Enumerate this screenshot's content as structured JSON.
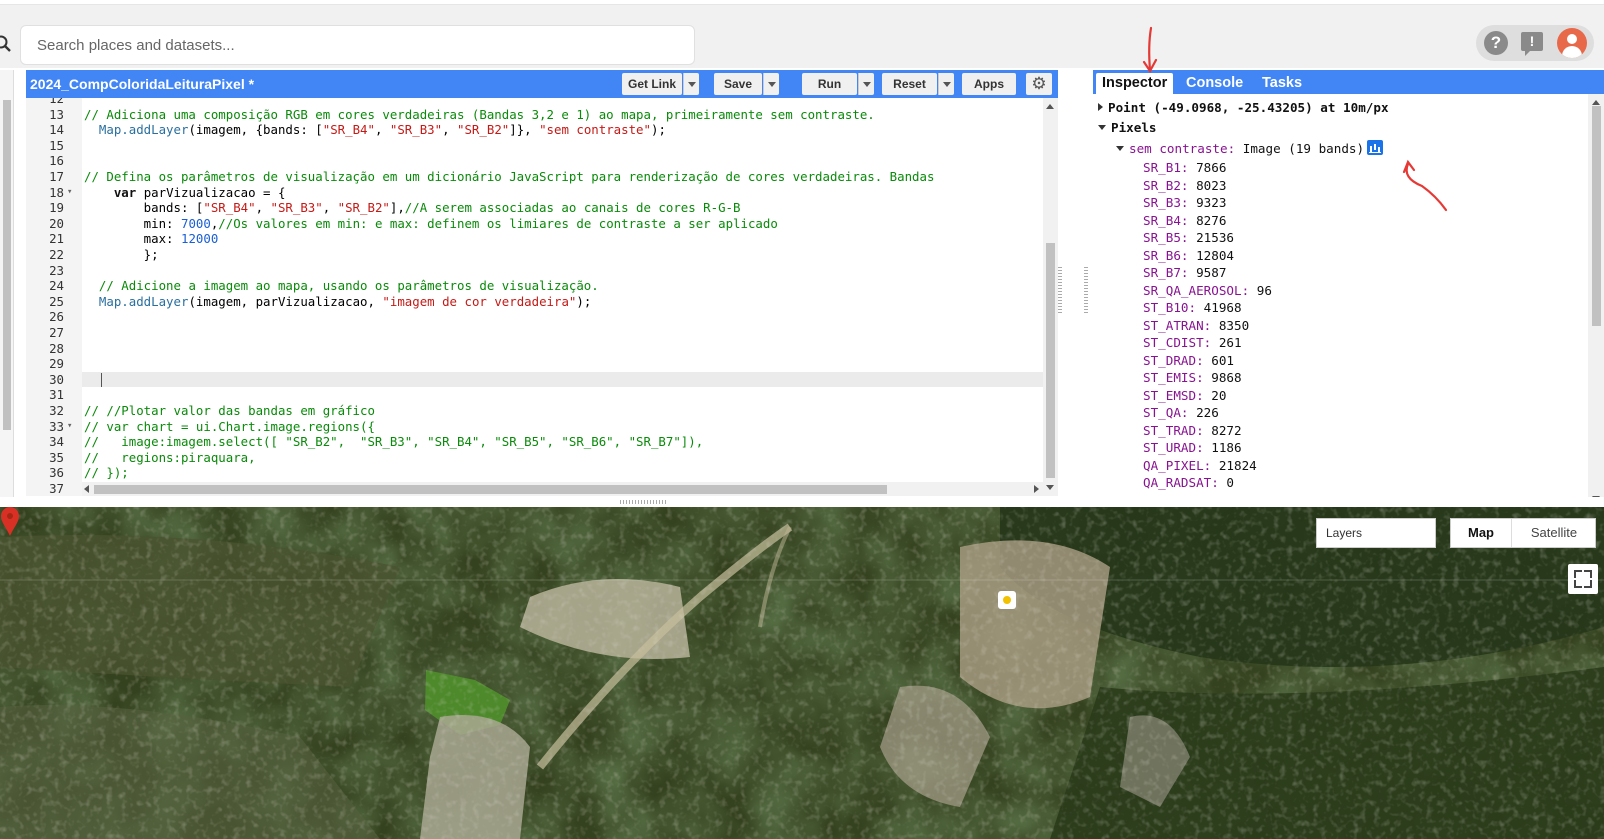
{
  "header": {
    "search_placeholder": "Search places and datasets..."
  },
  "editor": {
    "title": "2024_CompColoridaLeituraPixel *",
    "buttons": {
      "get_link": "Get Link",
      "save": "Save",
      "run": "Run",
      "reset": "Reset",
      "apps": "Apps"
    },
    "lines": [
      {
        "n": "12",
        "html": ""
      },
      {
        "n": "13",
        "html": "<span class=\"cm\">// Adiciona uma composição RGB em cores verdadeiras (Bandas 3,2 e 1) ao mapa, primeiramente sem contraste.</span>"
      },
      {
        "n": "14",
        "html": "  <span class=\"mp\">Map.addLayer</span>(imagem, {bands: [<span class=\"st\">\"SR_B4\"</span>, <span class=\"st\">\"SR_B3\"</span>, <span class=\"st\">\"SR_B2\"</span>]}, <span class=\"st\">\"sem contraste\"</span>);"
      },
      {
        "n": "15",
        "html": ""
      },
      {
        "n": "16",
        "html": ""
      },
      {
        "n": "17",
        "html": "<span class=\"cm\">// Defina os parâmetros de visualização em um dicionário JavaScript para renderização de cores verdadeiras. Bandas</span>"
      },
      {
        "n": "18",
        "fold": true,
        "html": "    <span class=\"kw\">var</span> parVizualizacao = {"
      },
      {
        "n": "19",
        "html": "        bands: [<span class=\"st\">\"SR_B4\"</span>, <span class=\"st\">\"SR_B3\"</span>, <span class=\"st\">\"SR_B2\"</span>],<span class=\"cm\">//A serem associadas ao canais de cores R-G-B</span>"
      },
      {
        "n": "20",
        "html": "        min: <span class=\"nm\">7000</span>,<span class=\"cm\">//Os valores em min: e max: definem os limiares de contraste a ser aplicado</span>"
      },
      {
        "n": "21",
        "html": "        max: <span class=\"nm\">12000</span>"
      },
      {
        "n": "22",
        "html": "        };"
      },
      {
        "n": "23",
        "html": ""
      },
      {
        "n": "24",
        "html": "  <span class=\"cm\">// Adicione a imagem ao mapa, usando os parâmetros de visualização.</span>"
      },
      {
        "n": "25",
        "html": "  <span class=\"mp\">Map.addLayer</span>(imagem, parVizualizacao, <span class=\"st\">\"imagem de cor verdadeira\"</span>);"
      },
      {
        "n": "26",
        "html": ""
      },
      {
        "n": "27",
        "html": ""
      },
      {
        "n": "28",
        "html": ""
      },
      {
        "n": "29",
        "html": ""
      },
      {
        "n": "30",
        "html": "",
        "active": true
      },
      {
        "n": "31",
        "html": ""
      },
      {
        "n": "32",
        "html": "<span class=\"cm\">// //Plotar valor das bandas em gráfico</span>"
      },
      {
        "n": "33",
        "fold": true,
        "html": "<span class=\"cm\">// var chart = ui.Chart.image.regions({</span>"
      },
      {
        "n": "34",
        "html": "<span class=\"cm\">//   image:imagem.select([ \"SR_B2\",  \"SR_B3\", \"SR_B4\", \"SR_B5\", \"SR_B6\", \"SR_B7\"]),</span>"
      },
      {
        "n": "35",
        "html": "<span class=\"cm\">//   regions:piraquara,</span>"
      },
      {
        "n": "36",
        "html": "<span class=\"cm\">// });</span>"
      },
      {
        "n": "37",
        "html": ""
      }
    ]
  },
  "inspector": {
    "tabs": [
      "Inspector",
      "Console",
      "Tasks"
    ],
    "point": "Point (-49.0968, -25.43205) at 10m/px",
    "pixels_label": "Pixels",
    "layer_name": "sem contraste:",
    "layer_desc": "Image (19 bands)",
    "bands": [
      {
        "k": "SR_B1:",
        "v": "7866"
      },
      {
        "k": "SR_B2:",
        "v": "8023"
      },
      {
        "k": "SR_B3:",
        "v": "9323"
      },
      {
        "k": "SR_B4:",
        "v": "8276"
      },
      {
        "k": "SR_B5:",
        "v": "21536"
      },
      {
        "k": "SR_B6:",
        "v": "12804"
      },
      {
        "k": "SR_B7:",
        "v": "9587"
      },
      {
        "k": "SR_QA_AEROSOL:",
        "v": "96"
      },
      {
        "k": "ST_B10:",
        "v": "41968"
      },
      {
        "k": "ST_ATRAN:",
        "v": "8350"
      },
      {
        "k": "ST_CDIST:",
        "v": "261"
      },
      {
        "k": "ST_DRAD:",
        "v": "601"
      },
      {
        "k": "ST_EMIS:",
        "v": "9868"
      },
      {
        "k": "ST_EMSD:",
        "v": "20"
      },
      {
        "k": "ST_QA:",
        "v": "226"
      },
      {
        "k": "ST_TRAD:",
        "v": "8272"
      },
      {
        "k": "ST_URAD:",
        "v": "1186"
      },
      {
        "k": "QA_PIXEL:",
        "v": "21824"
      },
      {
        "k": "QA_RADSAT:",
        "v": "0"
      }
    ]
  },
  "map": {
    "layers_label": "Layers",
    "map_label": "Map",
    "satellite_label": "Satellite"
  },
  "colors": {
    "accent": "#4285f4",
    "annotation": "#e53935"
  }
}
